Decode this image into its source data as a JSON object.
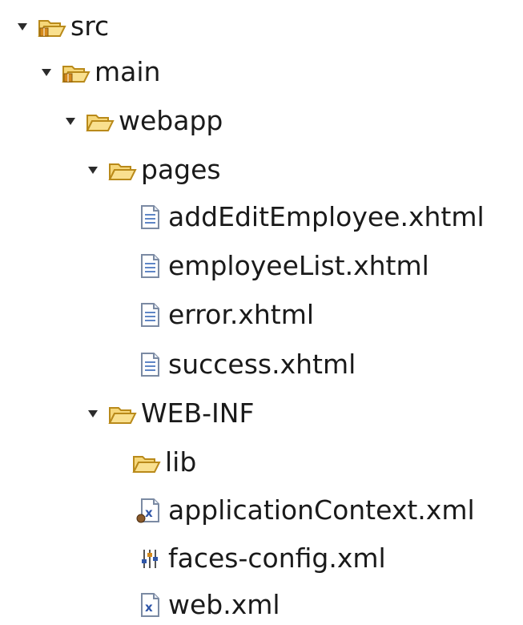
{
  "tree": {
    "items": [
      {
        "label": "src",
        "icon": "package-folder-open-icon"
      },
      {
        "label": "main",
        "icon": "package-folder-open-icon"
      },
      {
        "label": "webapp",
        "icon": "folder-open-icon"
      },
      {
        "label": "pages",
        "icon": "folder-open-icon"
      },
      {
        "label": "addEditEmployee.xhtml",
        "icon": "text-file-icon"
      },
      {
        "label": "employeeList.xhtml",
        "icon": "text-file-icon"
      },
      {
        "label": "error.xhtml",
        "icon": "text-file-icon"
      },
      {
        "label": "success.xhtml",
        "icon": "text-file-icon"
      },
      {
        "label": "WEB-INF",
        "icon": "folder-open-icon"
      },
      {
        "label": "lib",
        "icon": "folder-open-icon"
      },
      {
        "label": "applicationContext.xml",
        "icon": "spring-xml-file-icon"
      },
      {
        "label": "faces-config.xml",
        "icon": "faces-config-icon"
      },
      {
        "label": "web.xml",
        "icon": "xml-file-icon"
      }
    ]
  },
  "colors": {
    "folder_fill": "#f6d77a",
    "folder_stroke": "#b98a1a",
    "package_badge": "#d58a1b",
    "file_stroke": "#7b8aa3",
    "file_lines": "#5f86c6",
    "xml_blue": "#2f56a8"
  }
}
